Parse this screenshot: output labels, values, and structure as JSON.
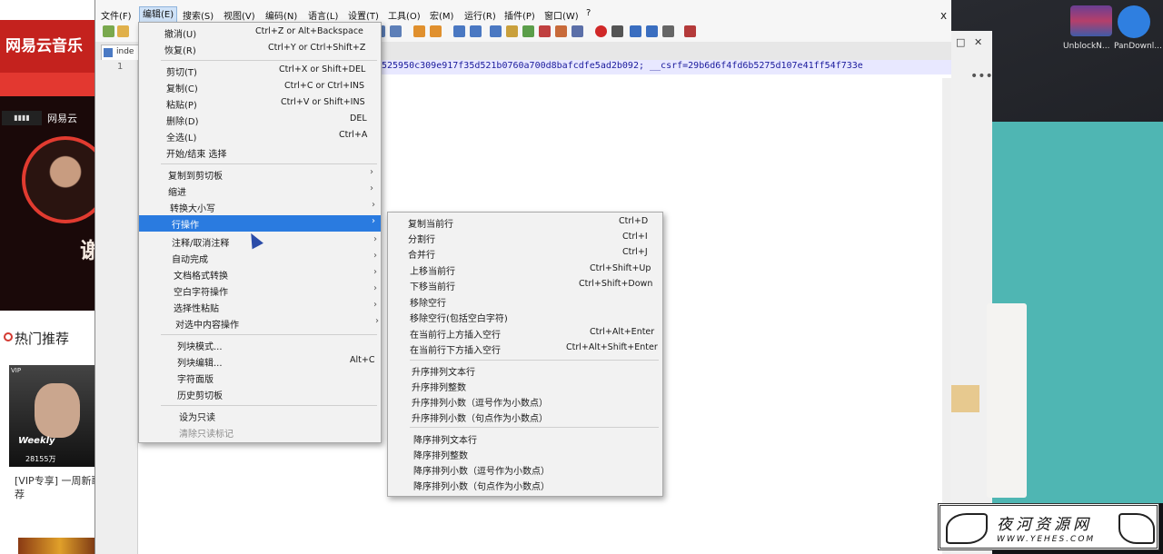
{
  "music_app": {
    "logo": "网易云音乐",
    "banner_badge_brand": "网易云",
    "banner_big_text": "谢",
    "hot_title": "热门推荐",
    "card_vip": "VIP",
    "card_title": "Weekly",
    "card_count": "28155万",
    "card_caption": "[VIP专享] 一周新歌推荐"
  },
  "desktop": {
    "icons": [
      {
        "label": "UnblockN...",
        "icon": "winrar-icon"
      },
      {
        "label": "PanDownl...",
        "icon": "cloud-icon"
      }
    ]
  },
  "editor": {
    "menubar": [
      "文件(F)",
      "编辑(E)",
      "搜索(S)",
      "视图(V)",
      "编码(N)",
      "语言(L)",
      "设置(T)",
      "工具(O)",
      "宏(M)",
      "运行(R)",
      "插件(P)",
      "窗口(W)",
      "?"
    ],
    "active_menu": "编辑(E)",
    "close_label": "x",
    "tab_label": "inde",
    "line_number": "1",
    "code_line": "525950c309e917f35d521b0760a700d8bafcdfe5ad2b092; __csrf=29b6d6f4fd6b5275d107e41ff54f733e"
  },
  "edit_menu": {
    "items": [
      {
        "label": "撤消(U)",
        "shortcut": "Ctrl+Z or Alt+Backspace",
        "disabled": false
      },
      {
        "label": "恢复(R)",
        "shortcut": "Ctrl+Y or Ctrl+Shift+Z",
        "disabled": false
      },
      {
        "label": "剪切(T)",
        "shortcut": "Ctrl+X or Shift+DEL",
        "disabled": false
      },
      {
        "label": "复制(C)",
        "shortcut": "Ctrl+C or Ctrl+INS",
        "disabled": false
      },
      {
        "label": "粘贴(P)",
        "shortcut": "Ctrl+V or Shift+INS",
        "disabled": false
      },
      {
        "label": "删除(D)",
        "shortcut": "DEL",
        "disabled": false
      },
      {
        "label": "全选(L)",
        "shortcut": "Ctrl+A",
        "disabled": false
      },
      {
        "label": "开始/结束 选择",
        "shortcut": "",
        "disabled": false
      },
      {
        "label": "复制到剪切板",
        "shortcut": "",
        "submenu": true
      },
      {
        "label": "缩进",
        "shortcut": "",
        "submenu": true
      },
      {
        "label": "转换大小写",
        "shortcut": "",
        "submenu": true
      },
      {
        "label": "行操作",
        "shortcut": "",
        "submenu": true,
        "highlighted": true
      },
      {
        "label": "注释/取消注释",
        "shortcut": "",
        "submenu": true
      },
      {
        "label": "自动完成",
        "shortcut": "",
        "submenu": true
      },
      {
        "label": "文档格式转换",
        "shortcut": "",
        "submenu": true
      },
      {
        "label": "空白字符操作",
        "shortcut": "",
        "submenu": true
      },
      {
        "label": "选择性粘贴",
        "shortcut": "",
        "submenu": true
      },
      {
        "label": "对选中内容操作",
        "shortcut": "",
        "submenu": true
      },
      {
        "label": "列块模式...",
        "shortcut": "",
        "disabled": false
      },
      {
        "label": "列块编辑...",
        "shortcut": "Alt+C",
        "disabled": false
      },
      {
        "label": "字符面版",
        "shortcut": "",
        "disabled": false
      },
      {
        "label": "历史剪切板",
        "shortcut": "",
        "disabled": false
      },
      {
        "label": "设为只读",
        "shortcut": "",
        "disabled": false
      },
      {
        "label": "清除只读标记",
        "shortcut": "",
        "disabled": true
      }
    ]
  },
  "line_menu": {
    "items": [
      {
        "label": "复制当前行",
        "shortcut": "Ctrl+D"
      },
      {
        "label": "分割行",
        "shortcut": "Ctrl+I"
      },
      {
        "label": "合并行",
        "shortcut": "Ctrl+J"
      },
      {
        "label": "上移当前行",
        "shortcut": "Ctrl+Shift+Up"
      },
      {
        "label": "下移当前行",
        "shortcut": "Ctrl+Shift+Down"
      },
      {
        "label": "移除空行",
        "shortcut": ""
      },
      {
        "label": "移除空行(包括空白字符)",
        "shortcut": ""
      },
      {
        "label": "在当前行上方插入空行",
        "shortcut": "Ctrl+Alt+Enter"
      },
      {
        "label": "在当前行下方插入空行",
        "shortcut": "Ctrl+Alt+Shift+Enter"
      },
      {
        "label": "升序排列文本行",
        "shortcut": ""
      },
      {
        "label": "升序排列整数",
        "shortcut": ""
      },
      {
        "label": "升序排列小数（逗号作为小数点）",
        "shortcut": ""
      },
      {
        "label": "升序排列小数（句点作为小数点）",
        "shortcut": ""
      },
      {
        "label": "降序排列文本行",
        "shortcut": ""
      },
      {
        "label": "降序排列整数",
        "shortcut": ""
      },
      {
        "label": "降序排列小数（逗号作为小数点）",
        "shortcut": ""
      },
      {
        "label": "降序排列小数（句点作为小数点）",
        "shortcut": ""
      }
    ]
  },
  "watermark": {
    "title": "夜河资源网",
    "url": "WWW.YEHES.COM"
  }
}
